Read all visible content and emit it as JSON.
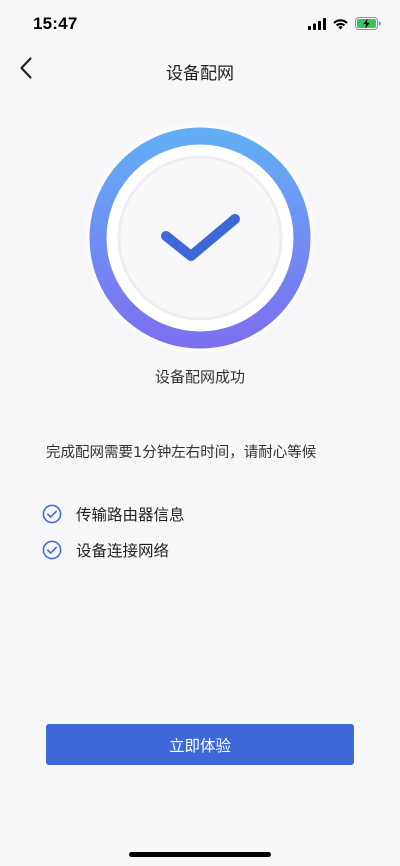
{
  "status_bar": {
    "time": "15:47",
    "icons": [
      "signal-icon",
      "wifi-icon",
      "battery-charging-icon"
    ]
  },
  "header": {
    "back_icon": "chevron-left-icon",
    "title": "设备配网"
  },
  "result": {
    "icon": "checkmark-icon",
    "label": "设备配网成功"
  },
  "tip": "完成配网需要1分钟左右时间，请耐心等候",
  "steps": [
    {
      "icon": "check-circle-icon",
      "label": "传输路由器信息"
    },
    {
      "icon": "check-circle-icon",
      "label": "设备连接网络"
    }
  ],
  "primary_button": {
    "label": "立即体验"
  },
  "colors": {
    "accent": "#3E68D8",
    "ring_gradient_top": "#63ADF5",
    "ring_gradient_bottom": "#7C70F0",
    "background": "#F7F7F9"
  }
}
